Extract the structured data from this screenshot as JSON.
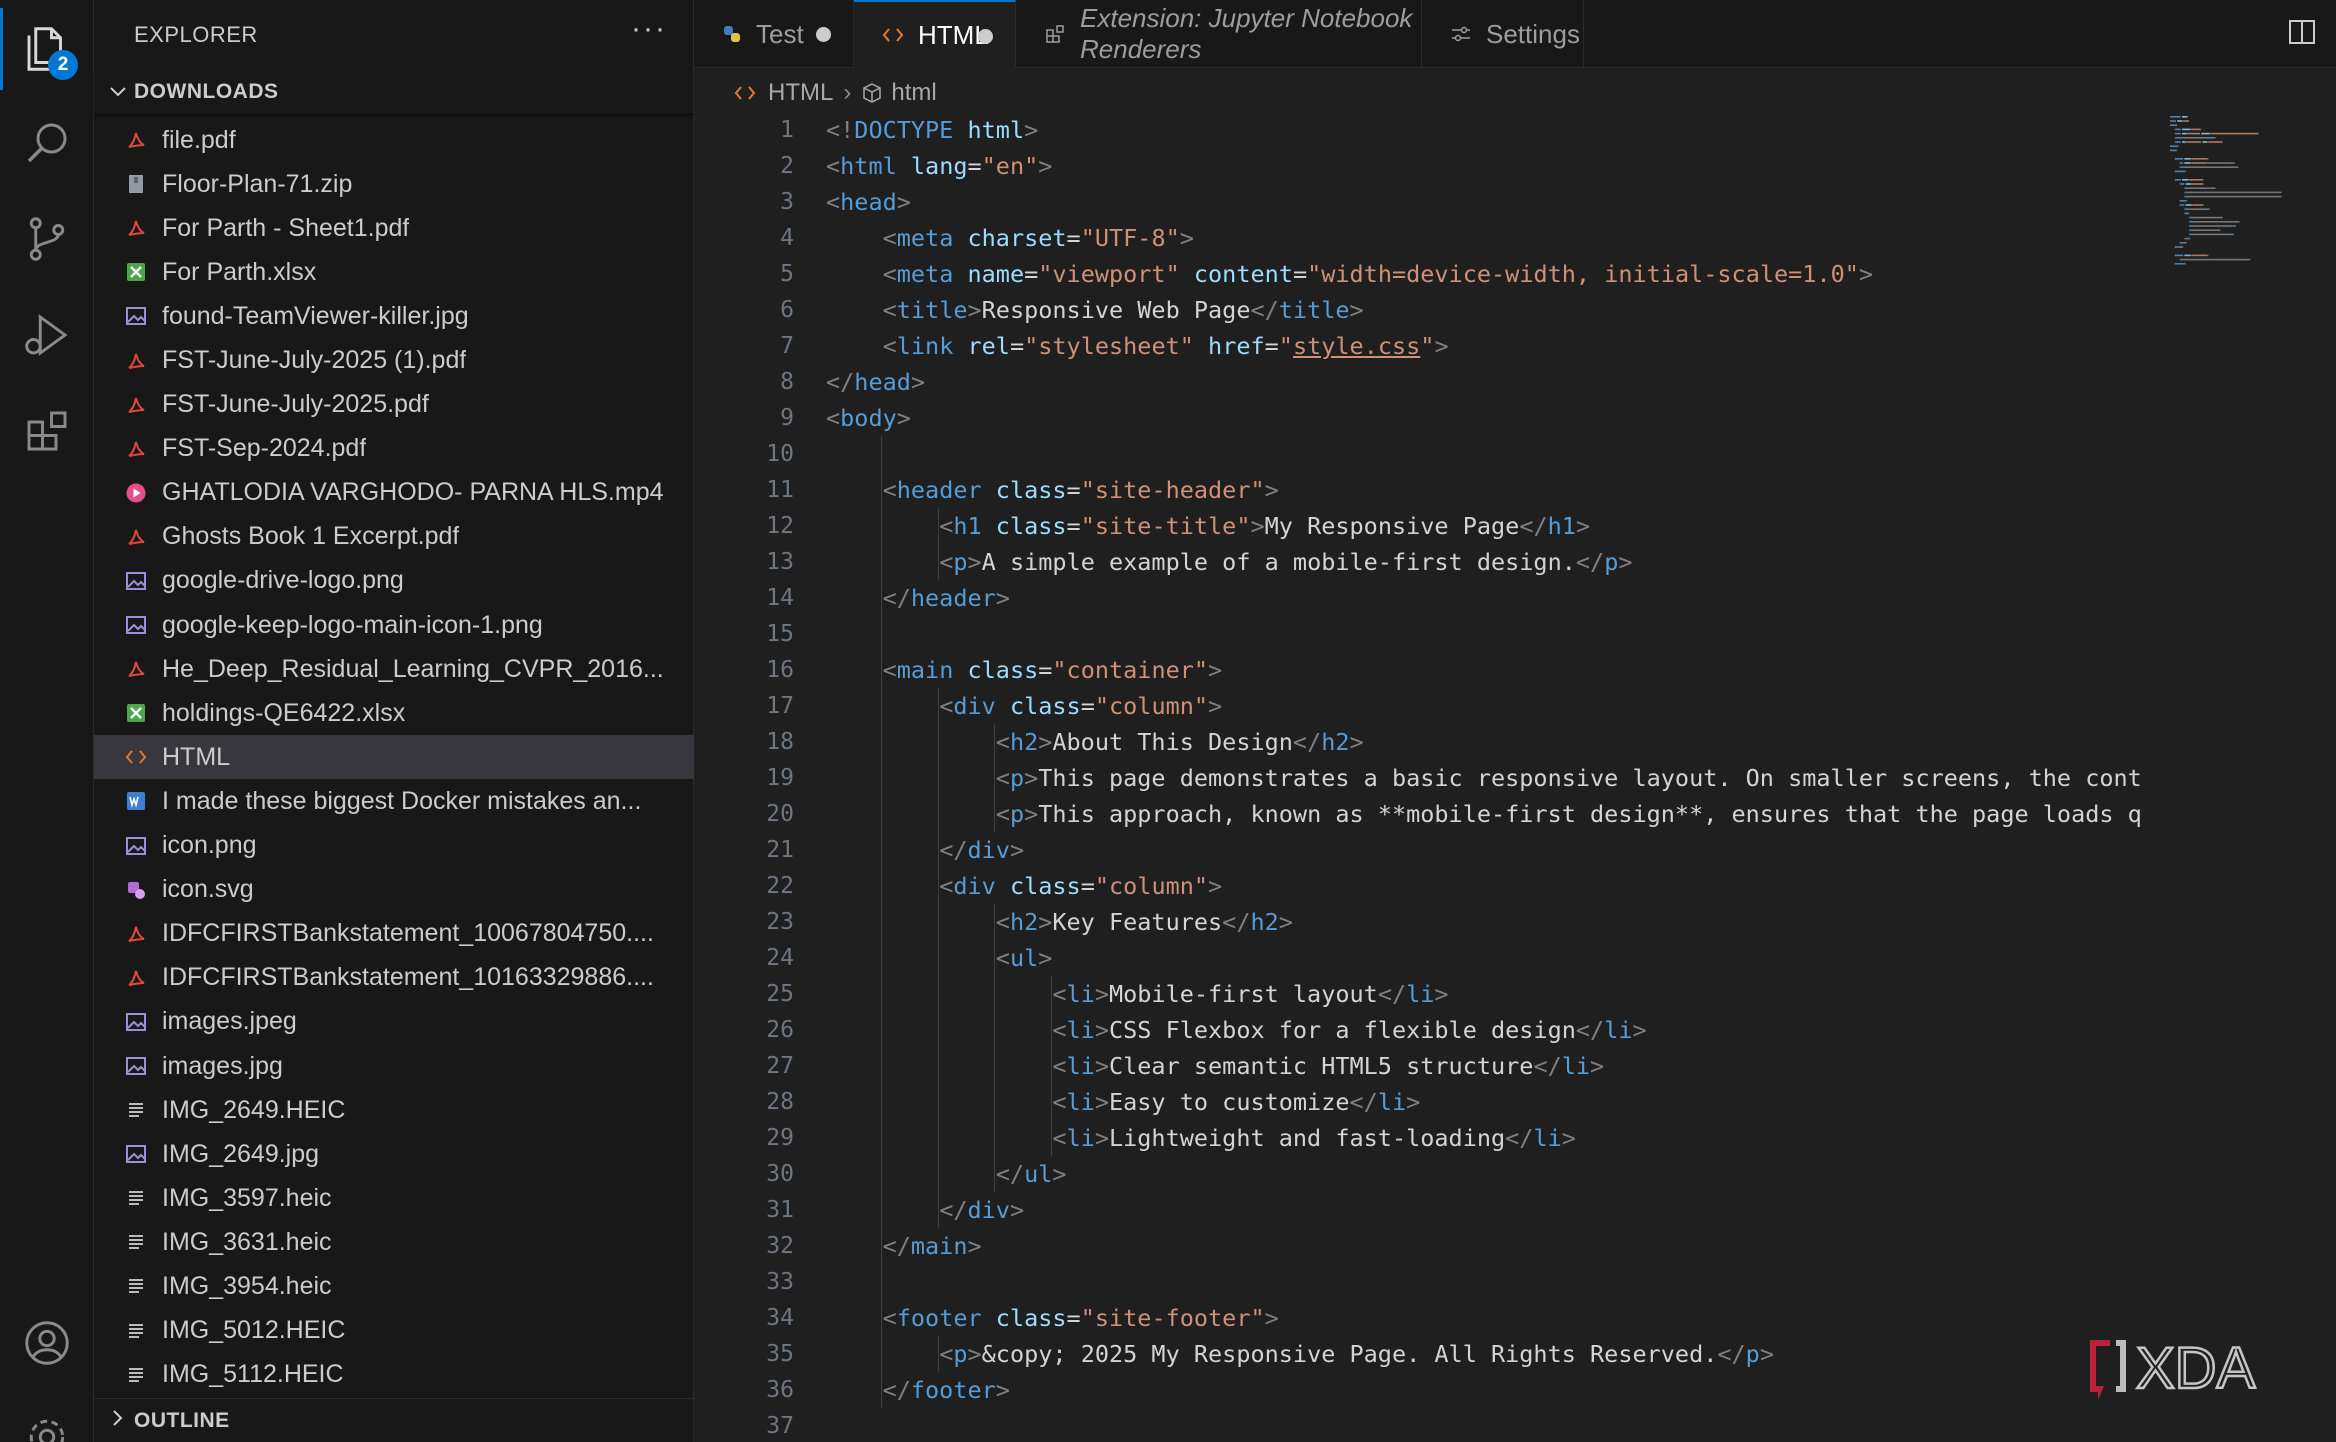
{
  "explorer": {
    "title": "EXPLORER",
    "more": "···",
    "section": "DOWNLOADS",
    "outline": "OUTLINE",
    "files": [
      {
        "name": "file.pdf",
        "icon": "pdf"
      },
      {
        "name": "Floor-Plan-71.zip",
        "icon": "zip"
      },
      {
        "name": "For Parth - Sheet1.pdf",
        "icon": "pdf"
      },
      {
        "name": "For Parth.xlsx",
        "icon": "excel"
      },
      {
        "name": "found-TeamViewer-killer.jpg",
        "icon": "image"
      },
      {
        "name": "FST-June-July-2025 (1).pdf",
        "icon": "pdf"
      },
      {
        "name": "FST-June-July-2025.pdf",
        "icon": "pdf"
      },
      {
        "name": "FST-Sep-2024.pdf",
        "icon": "pdf"
      },
      {
        "name": "GHATLODIA VARGHODO- PARNA HLS.mp4",
        "icon": "video"
      },
      {
        "name": "Ghosts Book 1 Excerpt.pdf",
        "icon": "pdf"
      },
      {
        "name": "google-drive-logo.png",
        "icon": "image"
      },
      {
        "name": "google-keep-logo-main-icon-1.png",
        "icon": "image"
      },
      {
        "name": "He_Deep_Residual_Learning_CVPR_2016...",
        "icon": "pdf"
      },
      {
        "name": "holdings-QE6422.xlsx",
        "icon": "excel"
      },
      {
        "name": "HTML",
        "icon": "html",
        "selected": true
      },
      {
        "name": "I made these biggest Docker mistakes an...",
        "icon": "word"
      },
      {
        "name": "icon.png",
        "icon": "image"
      },
      {
        "name": "icon.svg",
        "icon": "svg"
      },
      {
        "name": "IDFCFIRSTBankstatement_10067804750....",
        "icon": "pdf"
      },
      {
        "name": "IDFCFIRSTBankstatement_10163329886....",
        "icon": "pdf"
      },
      {
        "name": "images.jpeg",
        "icon": "image"
      },
      {
        "name": "images.jpg",
        "icon": "image"
      },
      {
        "name": "IMG_2649.HEIC",
        "icon": "lines"
      },
      {
        "name": "IMG_2649.jpg",
        "icon": "image"
      },
      {
        "name": "IMG_3597.heic",
        "icon": "lines"
      },
      {
        "name": "IMG_3631.heic",
        "icon": "lines"
      },
      {
        "name": "IMG_3954.heic",
        "icon": "lines"
      },
      {
        "name": "IMG_5012.HEIC",
        "icon": "lines"
      },
      {
        "name": "IMG_5112.HEIC",
        "icon": "lines"
      }
    ]
  },
  "activity": {
    "explorer_badge": "2"
  },
  "tabs": [
    {
      "label": "Test",
      "icon": "python-icon",
      "dirty": true,
      "active": false
    },
    {
      "label": "HTML",
      "icon": "html-icon",
      "dirty": true,
      "active": true
    },
    {
      "label": "Extension: Jupyter Notebook Renderers",
      "icon": "extension-icon",
      "italic": true
    },
    {
      "label": "Settings",
      "icon": "settings-sliders-icon"
    }
  ],
  "breadcrumb": {
    "file": "HTML",
    "separator": "›",
    "symbol": "html"
  },
  "code_lines": [
    [
      [
        "b",
        "<!"
      ],
      [
        "t",
        "DOCTYPE"
      ],
      [
        "x",
        " "
      ],
      [
        "a",
        "html"
      ],
      [
        "b",
        ">"
      ]
    ],
    [
      [
        "b",
        "<"
      ],
      [
        "t",
        "html"
      ],
      [
        "x",
        " "
      ],
      [
        "a",
        "lang"
      ],
      [
        "x",
        "="
      ],
      [
        "s",
        "\"en\""
      ],
      [
        "b",
        ">"
      ]
    ],
    [
      [
        "b",
        "<"
      ],
      [
        "t",
        "head"
      ],
      [
        "b",
        ">"
      ]
    ],
    [
      [
        "x",
        "    "
      ],
      [
        "b",
        "<"
      ],
      [
        "t",
        "meta"
      ],
      [
        "x",
        " "
      ],
      [
        "a",
        "charset"
      ],
      [
        "x",
        "="
      ],
      [
        "s",
        "\"UTF-8\""
      ],
      [
        "b",
        ">"
      ]
    ],
    [
      [
        "x",
        "    "
      ],
      [
        "b",
        "<"
      ],
      [
        "t",
        "meta"
      ],
      [
        "x",
        " "
      ],
      [
        "a",
        "name"
      ],
      [
        "x",
        "="
      ],
      [
        "s",
        "\"viewport\""
      ],
      [
        "x",
        " "
      ],
      [
        "a",
        "content"
      ],
      [
        "x",
        "="
      ],
      [
        "s",
        "\"width=device-width, initial-scale=1.0\""
      ],
      [
        "b",
        ">"
      ]
    ],
    [
      [
        "x",
        "    "
      ],
      [
        "b",
        "<"
      ],
      [
        "t",
        "title"
      ],
      [
        "b",
        ">"
      ],
      [
        "x",
        "Responsive Web Page"
      ],
      [
        "b",
        "</"
      ],
      [
        "t",
        "title"
      ],
      [
        "b",
        ">"
      ]
    ],
    [
      [
        "x",
        "    "
      ],
      [
        "b",
        "<"
      ],
      [
        "t",
        "link"
      ],
      [
        "x",
        " "
      ],
      [
        "a",
        "rel"
      ],
      [
        "x",
        "="
      ],
      [
        "s",
        "\"stylesheet\""
      ],
      [
        "x",
        " "
      ],
      [
        "a",
        "href"
      ],
      [
        "x",
        "="
      ],
      [
        "s",
        "\""
      ],
      [
        "u",
        "style.css"
      ],
      [
        "s",
        "\""
      ],
      [
        "b",
        ">"
      ]
    ],
    [
      [
        "b",
        "</"
      ],
      [
        "t",
        "head"
      ],
      [
        "b",
        ">"
      ]
    ],
    [
      [
        "b",
        "<"
      ],
      [
        "t",
        "body"
      ],
      [
        "b",
        ">"
      ]
    ],
    [],
    [
      [
        "x",
        "    "
      ],
      [
        "b",
        "<"
      ],
      [
        "t",
        "header"
      ],
      [
        "x",
        " "
      ],
      [
        "a",
        "class"
      ],
      [
        "x",
        "="
      ],
      [
        "s",
        "\"site-header\""
      ],
      [
        "b",
        ">"
      ]
    ],
    [
      [
        "x",
        "        "
      ],
      [
        "b",
        "<"
      ],
      [
        "t",
        "h1"
      ],
      [
        "x",
        " "
      ],
      [
        "a",
        "class"
      ],
      [
        "x",
        "="
      ],
      [
        "s",
        "\"site-title\""
      ],
      [
        "b",
        ">"
      ],
      [
        "x",
        "My Responsive Page"
      ],
      [
        "b",
        "</"
      ],
      [
        "t",
        "h1"
      ],
      [
        "b",
        ">"
      ]
    ],
    [
      [
        "x",
        "        "
      ],
      [
        "b",
        "<"
      ],
      [
        "t",
        "p"
      ],
      [
        "b",
        ">"
      ],
      [
        "x",
        "A simple example of a mobile-first design."
      ],
      [
        "b",
        "</"
      ],
      [
        "t",
        "p"
      ],
      [
        "b",
        ">"
      ]
    ],
    [
      [
        "x",
        "    "
      ],
      [
        "b",
        "</"
      ],
      [
        "t",
        "header"
      ],
      [
        "b",
        ">"
      ]
    ],
    [],
    [
      [
        "x",
        "    "
      ],
      [
        "b",
        "<"
      ],
      [
        "t",
        "main"
      ],
      [
        "x",
        " "
      ],
      [
        "a",
        "class"
      ],
      [
        "x",
        "="
      ],
      [
        "s",
        "\"container\""
      ],
      [
        "b",
        ">"
      ]
    ],
    [
      [
        "x",
        "        "
      ],
      [
        "b",
        "<"
      ],
      [
        "t",
        "div"
      ],
      [
        "x",
        " "
      ],
      [
        "a",
        "class"
      ],
      [
        "x",
        "="
      ],
      [
        "s",
        "\"column\""
      ],
      [
        "b",
        ">"
      ]
    ],
    [
      [
        "x",
        "            "
      ],
      [
        "b",
        "<"
      ],
      [
        "t",
        "h2"
      ],
      [
        "b",
        ">"
      ],
      [
        "x",
        "About This Design"
      ],
      [
        "b",
        "</"
      ],
      [
        "t",
        "h2"
      ],
      [
        "b",
        ">"
      ]
    ],
    [
      [
        "x",
        "            "
      ],
      [
        "b",
        "<"
      ],
      [
        "t",
        "p"
      ],
      [
        "b",
        ">"
      ],
      [
        "x",
        "This page demonstrates a basic responsive layout. On smaller screens, the cont"
      ]
    ],
    [
      [
        "x",
        "            "
      ],
      [
        "b",
        "<"
      ],
      [
        "t",
        "p"
      ],
      [
        "b",
        ">"
      ],
      [
        "x",
        "This approach, known as **mobile-first design**, ensures that the page loads q"
      ]
    ],
    [
      [
        "x",
        "        "
      ],
      [
        "b",
        "</"
      ],
      [
        "t",
        "div"
      ],
      [
        "b",
        ">"
      ]
    ],
    [
      [
        "x",
        "        "
      ],
      [
        "b",
        "<"
      ],
      [
        "t",
        "div"
      ],
      [
        "x",
        " "
      ],
      [
        "a",
        "class"
      ],
      [
        "x",
        "="
      ],
      [
        "s",
        "\"column\""
      ],
      [
        "b",
        ">"
      ]
    ],
    [
      [
        "x",
        "            "
      ],
      [
        "b",
        "<"
      ],
      [
        "t",
        "h2"
      ],
      [
        "b",
        ">"
      ],
      [
        "x",
        "Key Features"
      ],
      [
        "b",
        "</"
      ],
      [
        "t",
        "h2"
      ],
      [
        "b",
        ">"
      ]
    ],
    [
      [
        "x",
        "            "
      ],
      [
        "b",
        "<"
      ],
      [
        "t",
        "ul"
      ],
      [
        "b",
        ">"
      ]
    ],
    [
      [
        "x",
        "                "
      ],
      [
        "b",
        "<"
      ],
      [
        "t",
        "li"
      ],
      [
        "b",
        ">"
      ],
      [
        "x",
        "Mobile-first layout"
      ],
      [
        "b",
        "</"
      ],
      [
        "t",
        "li"
      ],
      [
        "b",
        ">"
      ]
    ],
    [
      [
        "x",
        "                "
      ],
      [
        "b",
        "<"
      ],
      [
        "t",
        "li"
      ],
      [
        "b",
        ">"
      ],
      [
        "x",
        "CSS Flexbox for a flexible design"
      ],
      [
        "b",
        "</"
      ],
      [
        "t",
        "li"
      ],
      [
        "b",
        ">"
      ]
    ],
    [
      [
        "x",
        "                "
      ],
      [
        "b",
        "<"
      ],
      [
        "t",
        "li"
      ],
      [
        "b",
        ">"
      ],
      [
        "x",
        "Clear semantic HTML5 structure"
      ],
      [
        "b",
        "</"
      ],
      [
        "t",
        "li"
      ],
      [
        "b",
        ">"
      ]
    ],
    [
      [
        "x",
        "                "
      ],
      [
        "b",
        "<"
      ],
      [
        "t",
        "li"
      ],
      [
        "b",
        ">"
      ],
      [
        "x",
        "Easy to customize"
      ],
      [
        "b",
        "</"
      ],
      [
        "t",
        "li"
      ],
      [
        "b",
        ">"
      ]
    ],
    [
      [
        "x",
        "                "
      ],
      [
        "b",
        "<"
      ],
      [
        "t",
        "li"
      ],
      [
        "b",
        ">"
      ],
      [
        "x",
        "Lightweight and fast-loading"
      ],
      [
        "b",
        "</"
      ],
      [
        "t",
        "li"
      ],
      [
        "b",
        ">"
      ]
    ],
    [
      [
        "x",
        "            "
      ],
      [
        "b",
        "</"
      ],
      [
        "t",
        "ul"
      ],
      [
        "b",
        ">"
      ]
    ],
    [
      [
        "x",
        "        "
      ],
      [
        "b",
        "</"
      ],
      [
        "t",
        "div"
      ],
      [
        "b",
        ">"
      ]
    ],
    [
      [
        "x",
        "    "
      ],
      [
        "b",
        "</"
      ],
      [
        "t",
        "main"
      ],
      [
        "b",
        ">"
      ]
    ],
    [],
    [
      [
        "x",
        "    "
      ],
      [
        "b",
        "<"
      ],
      [
        "t",
        "footer"
      ],
      [
        "x",
        " "
      ],
      [
        "a",
        "class"
      ],
      [
        "x",
        "="
      ],
      [
        "s",
        "\"site-footer\""
      ],
      [
        "b",
        ">"
      ]
    ],
    [
      [
        "x",
        "        "
      ],
      [
        "b",
        "<"
      ],
      [
        "t",
        "p"
      ],
      [
        "b",
        ">"
      ],
      [
        "x",
        "&copy; 2025 My Responsive Page. All Rights Reserved."
      ],
      [
        "b",
        "</"
      ],
      [
        "t",
        "p"
      ],
      [
        "b",
        ">"
      ]
    ],
    [
      [
        "x",
        "    "
      ],
      [
        "b",
        "</"
      ],
      [
        "t",
        "footer"
      ],
      [
        "b",
        ">"
      ]
    ],
    []
  ],
  "watermark": {
    "text": "XDA"
  },
  "colors": {
    "accent": "#0078d4",
    "tag": "#569cd6",
    "attr": "#9cdcfe",
    "string": "#ce9178",
    "pdf": "#e2473b",
    "excel": "#4ea54a",
    "image": "#9c8fd8",
    "video": "#e6508a",
    "html": "#e37933",
    "word": "#3c7fd3"
  }
}
